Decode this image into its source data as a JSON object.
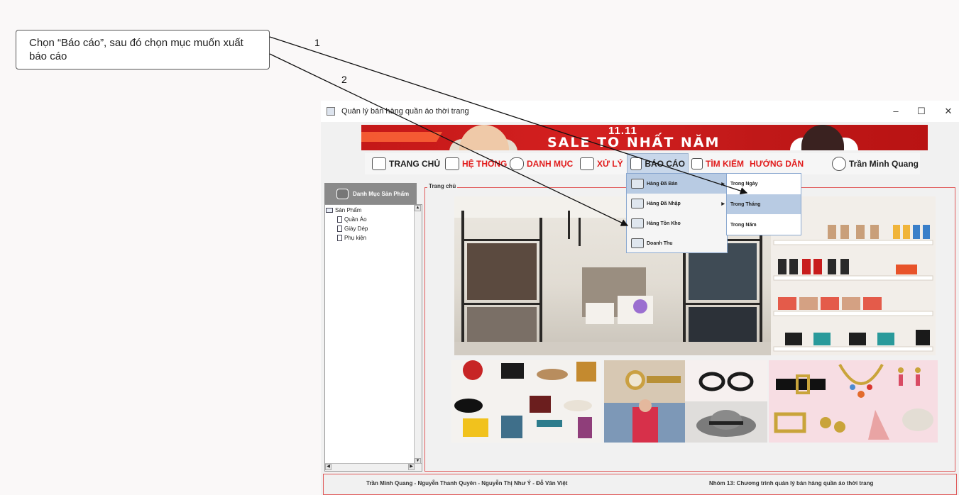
{
  "annotation": {
    "callout_text": "Chọn “Báo cáo”, sau đó chọn mục muốn xuất báo cáo",
    "arrow_labels": [
      "1",
      "2"
    ]
  },
  "window": {
    "title": "Quản lý bán hàng quần áo thời trang",
    "controls": {
      "minimize": "–",
      "maximize": "☐",
      "close": "✕"
    }
  },
  "banner": {
    "top_text": "11.11",
    "main_text": "SALE TO NHẤT NĂM"
  },
  "menu": {
    "home": "TRANG CHỦ",
    "system": "HỆ THỐNG",
    "catalog": "DANH MỤC",
    "process": "XỬ LÝ",
    "report": "BÁO CÁO",
    "search": "TÌM KIẾM",
    "guide": "HƯỚNG DẪN",
    "user": "Trần Minh Quang"
  },
  "report_menu": {
    "items": [
      "Hàng Đã Bán",
      "Hàng Đã Nhập",
      "Hàng Tồn Kho",
      "Doanh Thu"
    ],
    "submenu": [
      "Trong Ngày",
      "Trong Tháng",
      "Trong Năm"
    ]
  },
  "sidebar": {
    "header": "Danh Mục Sản Phẩm",
    "root": "Sản Phẩm",
    "children": [
      "Quần Áo",
      "Giày Dép",
      "Phụ kiện"
    ]
  },
  "main": {
    "tab_label": "Trang chủ"
  },
  "footer": {
    "authors": "Trần Minh Quang - Nguyễn Thanh Quyên - Nguyễn Thị Như Ý - Đỗ Văn Việt",
    "group": "Nhóm 13: Chương trình quản lý bán hàng quần áo thời trang"
  },
  "colors": {
    "accent_red": "#e11b1b",
    "menu_highlight": "#c8d7ea",
    "submenu_highlight": "#b8cbe3"
  }
}
